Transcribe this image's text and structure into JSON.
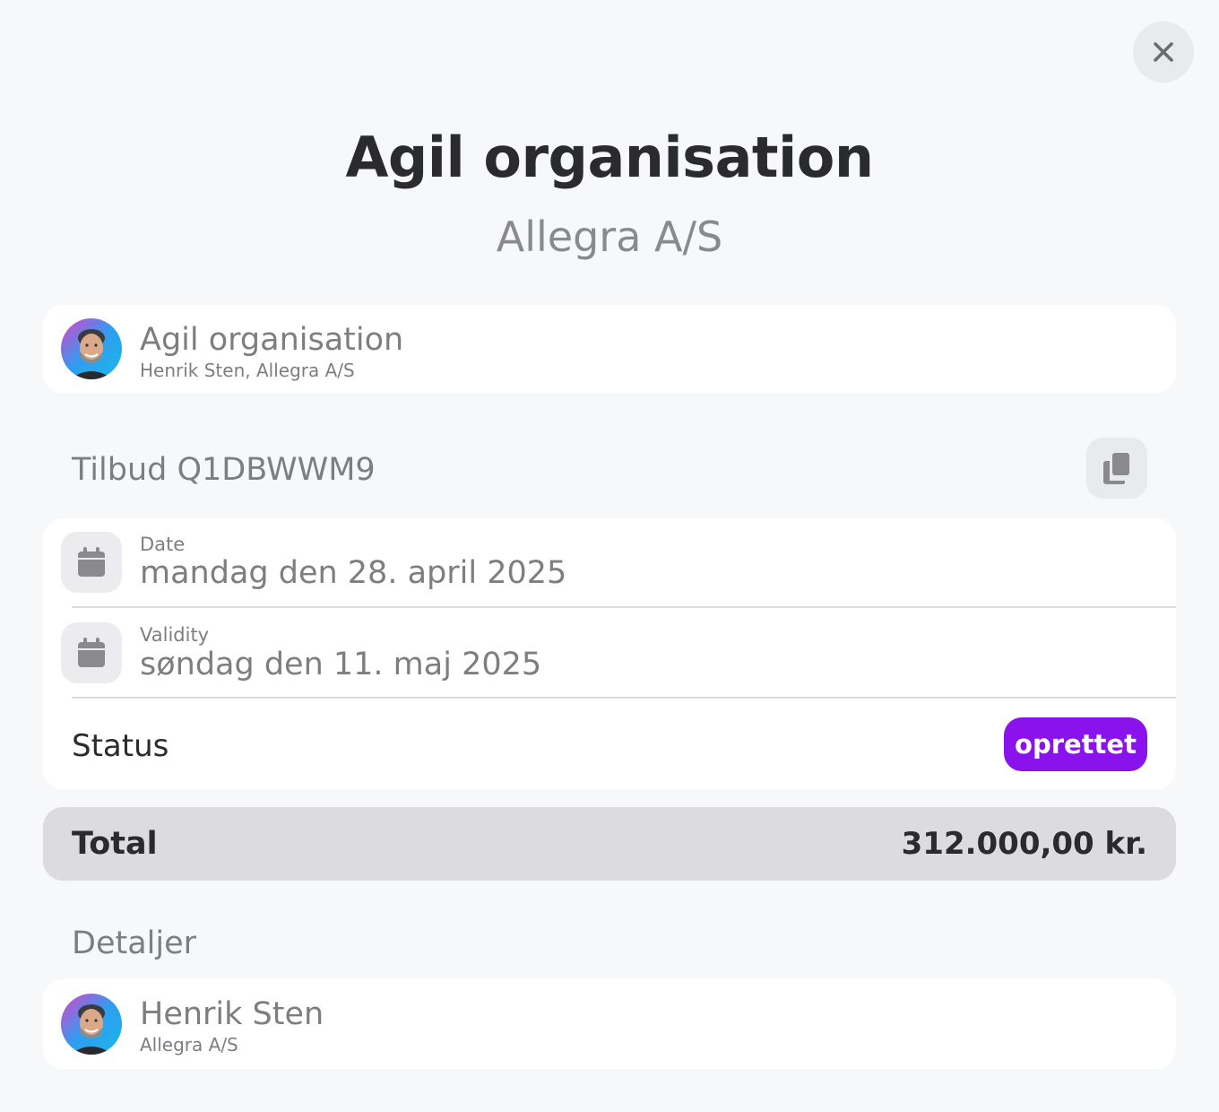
{
  "header": {
    "title": "Agil organisation",
    "subtitle": "Allegra A/S"
  },
  "summary_card": {
    "name": "Agil organisation",
    "sub": "Henrik Sten, Allegra A/S"
  },
  "offer": {
    "label": "Tilbud Q1DBWWM9"
  },
  "info": {
    "date_label": "Date",
    "date_value": "mandag den 28. april 2025",
    "validity_label": "Validity",
    "validity_value": "søndag den 11. maj 2025",
    "status_label": "Status",
    "status_value": "oprettet"
  },
  "total": {
    "label": "Total",
    "value": "312.000,00 kr."
  },
  "details": {
    "label": "Detaljer",
    "name": "Henrik Sten",
    "sub": "Allegra A/S"
  },
  "colors": {
    "accent": "#8a12ec",
    "background": "#f7f8fa",
    "card": "#ffffff",
    "muted_text": "#7e7e82",
    "dark_text": "#2b2b2e"
  },
  "icons": {
    "close": "close-icon",
    "copy": "copy-icon",
    "calendar": "calendar-icon"
  }
}
